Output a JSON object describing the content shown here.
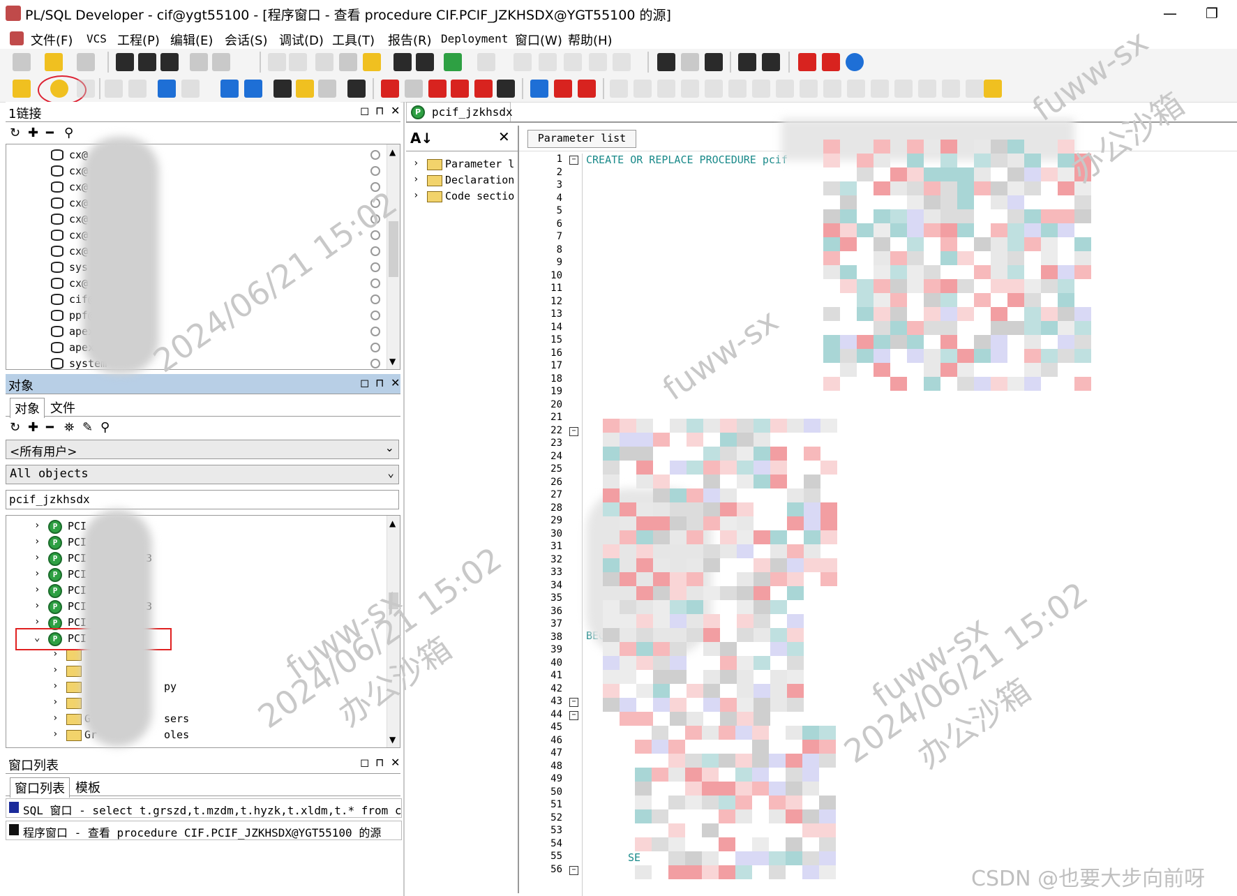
{
  "window": {
    "title": "PL/SQL Developer - cif@ygt55100 - [程序窗口 - 查看 procedure CIF.PCIF_JZKHSDX@YGT55100 的源]",
    "minimize": "—",
    "restore": "❐"
  },
  "menu": [
    "文件(F)",
    "VCS",
    "工程(P)",
    "编辑(E)",
    "会话(S)",
    "调试(D)",
    "工具(T)",
    "报告(R)",
    "Deployment",
    "窗口(W)",
    "帮助(H)"
  ],
  "connections_pane": {
    "title": "1链接",
    "items": [
      "cx@",
      "cx@",
      "cx@",
      "cx@",
      "cx@",
      "cx@",
      "cx@",
      "sys",
      "cx@",
      "cif@",
      "ppf@",
      "apex@",
      "apex@",
      "system"
    ]
  },
  "objects_pane": {
    "title": "对象",
    "tabs": [
      "对象",
      "文件"
    ],
    "user_filter": "<所有用户>",
    "type_filter": "All objects",
    "search_value": "pcif_jzkhsdx",
    "items": [
      "PCI",
      "PCI",
      "PCI",
      "PCI",
      "PCI",
      "PCI",
      "PCI",
      "PCI"
    ],
    "item_suffixes": [
      "",
      "",
      "3",
      "",
      "",
      "3",
      "",
      ""
    ],
    "children": [
      "",
      "",
      "",
      "",
      "G",
      "Gr"
    ],
    "child_suffixes": [
      "",
      "",
      "py",
      "",
      "sers",
      "oles"
    ]
  },
  "windows_pane": {
    "title": "窗口列表",
    "tabs": [
      "窗口列表",
      "模板"
    ],
    "rows": [
      "SQL 窗口 - select t.grszd,t.mzdm,t.hyzk,t.xldm,t.* from cif.tgr",
      "程序窗口 - 查看 procedure CIF.PCIF_JZKHSDX@YGT55100 的源"
    ]
  },
  "editor": {
    "doc_tab": "pcif_jzkhsdx",
    "outline_items": [
      "Parameter l",
      "Declaration",
      "Code sectio"
    ],
    "param_button": "Parameter list",
    "line1": "CREATE OR REPLACE PROCEDURE pcif",
    "line31": "l_l",
    "line32": "l",
    "line38": "BEG",
    "line56": "SE",
    "line_count": 56,
    "fold_lines": [
      1,
      22,
      43,
      44,
      56
    ]
  },
  "watermarks": [
    "fuww-sx",
    "2024/06/21 15:02",
    "办公沙箱"
  ],
  "footer_credit": "CSDN @也要大步向前呀",
  "colors": {
    "keyword": "#1a8a8a",
    "highlight_red": "#e0343a",
    "pane_header_active": "#b8cfe6"
  }
}
